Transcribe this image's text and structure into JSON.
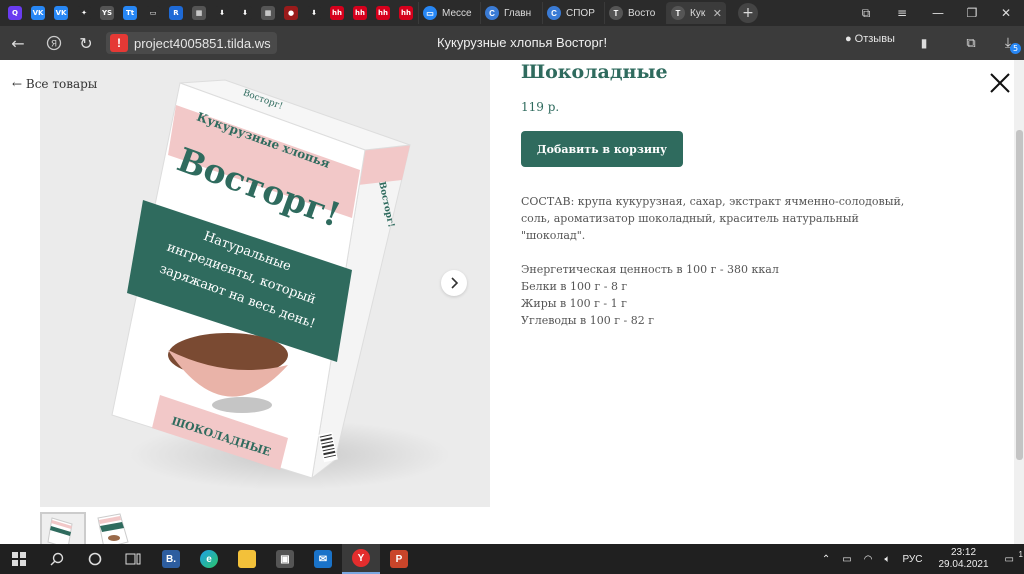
{
  "browser": {
    "pinned_tabs": [
      {
        "icon": "yandex-icon",
        "color": "#6a3cf0",
        "glyph": "Q"
      },
      {
        "icon": "vk-icon",
        "color": "#2787f5",
        "glyph": "VK"
      },
      {
        "icon": "vk-icon",
        "color": "#2787f5",
        "glyph": "VK"
      },
      {
        "icon": "sparkle-icon",
        "color": "#2b2b2b",
        "glyph": "✦"
      },
      {
        "icon": "site-icon",
        "color": "#555555",
        "glyph": "YS"
      },
      {
        "icon": "site-icon",
        "color": "#2787f5",
        "glyph": "Tt"
      },
      {
        "icon": "message-icon",
        "color": "#2b2b2b",
        "glyph": "▭"
      },
      {
        "icon": "site-icon",
        "color": "#1e6ad6",
        "glyph": "R"
      },
      {
        "icon": "site-icon",
        "color": "#555555",
        "glyph": "▦"
      },
      {
        "icon": "download-icon",
        "color": "#2b2b2b",
        "glyph": "⬇"
      },
      {
        "icon": "download-icon",
        "color": "#2b2b2b",
        "glyph": "⬇"
      },
      {
        "icon": "site-icon",
        "color": "#555555",
        "glyph": "▦"
      },
      {
        "icon": "site-icon",
        "color": "#9a1b1b",
        "glyph": "●"
      },
      {
        "icon": "download-icon",
        "color": "#2b2b2b",
        "glyph": "⬇"
      },
      {
        "icon": "hh-icon",
        "color": "#d6001c",
        "glyph": "hh"
      },
      {
        "icon": "hh-icon",
        "color": "#d6001c",
        "glyph": "hh"
      },
      {
        "icon": "hh-icon",
        "color": "#d6001c",
        "glyph": "hh"
      },
      {
        "icon": "hh-icon",
        "color": "#d6001c",
        "glyph": "hh"
      }
    ],
    "tabs": [
      {
        "label": "Мессе",
        "color": "#2787f5",
        "glyph": "▭"
      },
      {
        "label": "Главн",
        "color": "#3a7bd5",
        "glyph": "C"
      },
      {
        "label": "СПОР",
        "color": "#3a7bd5",
        "glyph": "C"
      },
      {
        "label": "Восто",
        "color": "#555555",
        "glyph": "T"
      },
      {
        "label": "Кук",
        "color": "#555555",
        "glyph": "T",
        "active": true
      }
    ],
    "address": "project4005851.tilda.ws",
    "page_title": "Кукурузные хлопья Восторг!",
    "reviews_label": "Отзывы",
    "download_badge": "5"
  },
  "page": {
    "back_label": "← Все товары",
    "product_title": "Шоколадные",
    "price": "119 р.",
    "add_to_cart": "Добавить в корзину",
    "description": {
      "composition": "СОСТАВ: крупа кукурузная, сахар, экстракт ячменно-солодовый, соль, ароматизатор шоколадный, краситель натуральный \"шоколад\".",
      "energy": "Энергетическая ценность в 100 г - 380 ккал",
      "protein": "Белки в 100 г - 8 г",
      "fat": "Жиры в 100 г - 1 г",
      "carbs": "Углеводы в 100 г - 82 г"
    },
    "package": {
      "brand_small": "Восторг!",
      "subtitle": "Кукурузные хлопья",
      "brand": "Восторг!",
      "slogan_1": "Натуральные",
      "slogan_2": "ингредиенты, который",
      "slogan_3": "заряжают на весь день!",
      "flavor": "ШОКОЛАДНЫЕ",
      "side_brand": "Восторг!"
    },
    "colors": {
      "accent": "#2f6b5e",
      "package_pink": "#f2c8c8",
      "package_green": "#2f6b5e"
    }
  },
  "taskbar": {
    "language": "РУС",
    "time": "23:12",
    "date": "29.04.2021",
    "notifications": "1"
  }
}
